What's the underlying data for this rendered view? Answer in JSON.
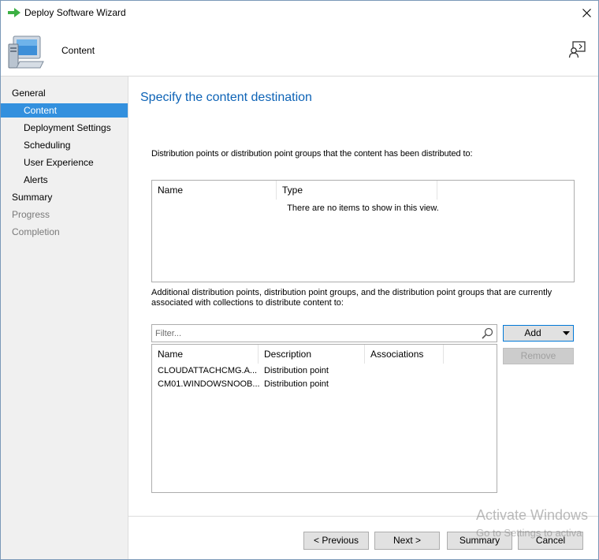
{
  "window": {
    "title": "Deploy Software Wizard"
  },
  "header": {
    "title": "Content"
  },
  "sidebar": {
    "items": [
      {
        "label": "General",
        "level": 0,
        "state": "normal"
      },
      {
        "label": "Content",
        "level": 1,
        "state": "active"
      },
      {
        "label": "Deployment Settings",
        "level": 1,
        "state": "normal"
      },
      {
        "label": "Scheduling",
        "level": 1,
        "state": "normal"
      },
      {
        "label": "User Experience",
        "level": 1,
        "state": "normal"
      },
      {
        "label": "Alerts",
        "level": 1,
        "state": "normal"
      },
      {
        "label": "Summary",
        "level": 0,
        "state": "normal"
      },
      {
        "label": "Progress",
        "level": 0,
        "state": "disabled"
      },
      {
        "label": "Completion",
        "level": 0,
        "state": "disabled"
      }
    ]
  },
  "main": {
    "heading": "Specify the content destination",
    "distributed_label": "Distribution points or distribution point groups that the content has been distributed to:",
    "distributed_list": {
      "columns": [
        "Name",
        "Type"
      ],
      "empty_message": "There are no items to show in this view."
    },
    "additional_label": "Additional distribution points, distribution point groups, and the distribution point groups that are currently associated with collections to distribute content to:",
    "filter": {
      "placeholder": "Filter...",
      "value": ""
    },
    "additional_list": {
      "columns": [
        "Name",
        "Description",
        "Associations"
      ],
      "rows": [
        {
          "name": "CLOUDATTACHCMG.A...",
          "description": "Distribution point",
          "associations": ""
        },
        {
          "name": "CM01.WINDOWSNOOB...",
          "description": "Distribution point",
          "associations": ""
        }
      ]
    },
    "add_button": "Add",
    "remove_button": "Remove"
  },
  "footer": {
    "previous": "< Previous",
    "next": "Next >",
    "summary": "Summary",
    "cancel": "Cancel"
  },
  "watermark": {
    "line1": "Activate Windows",
    "line2": "Go to Settings to activa"
  },
  "colors": {
    "accent": "#3390de",
    "heading": "#0d63b6",
    "sidebar_bg": "#f0f0f0",
    "button_bg": "#e1e1e1"
  }
}
